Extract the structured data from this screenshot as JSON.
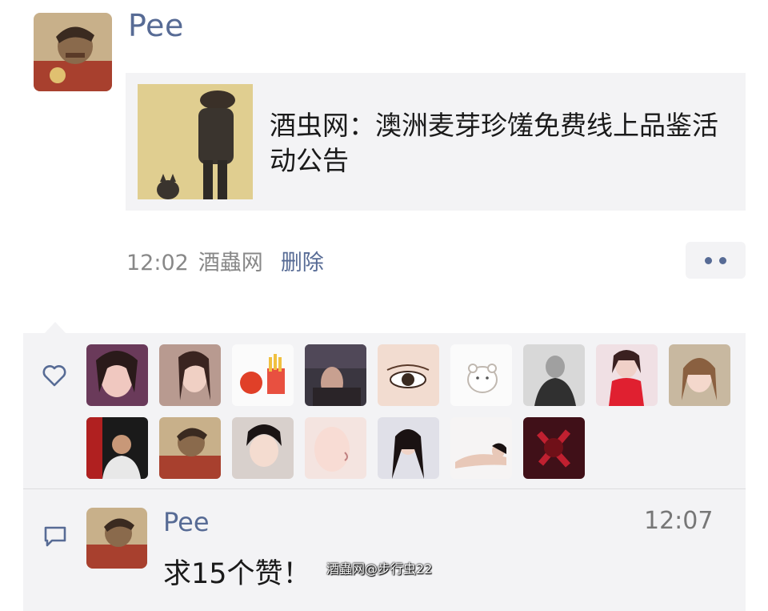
{
  "post": {
    "user": "Pee",
    "avatar": "iron-man-avatar",
    "link_card": {
      "thumbnail": "silhouette-man-with-cat-painting",
      "title": "酒虫网：澳洲麦芽珍馐免费线上品鉴活动公告"
    },
    "meta": {
      "time": "12:02",
      "source": "酒蟲网",
      "delete_label": "删除"
    },
    "more_icon": "more-dots-icon"
  },
  "likes": {
    "icon": "heart-icon",
    "avatars": [
      "woman-selfie",
      "woman-long-hair",
      "tomato-and-fries-cartoon",
      "woman-sitting-room",
      "eye-closeup",
      "bear-doodle",
      "monochrome-person-sitting",
      "woman-red-dress",
      "woman-bangs",
      "man-with-poster",
      "iron-man-avatar",
      "woman-portrait",
      "woman-face-closeup",
      "woman-black-hair",
      "woman-lying-bed",
      "dark-red-artwork"
    ]
  },
  "comment": {
    "icon": "comment-icon",
    "user": "Pee",
    "time": "12:07",
    "text": "求15个赞！"
  },
  "watermark": "酒蟲网@步行虫22",
  "colors": {
    "link_blue": "#576b95",
    "panel_bg": "#f3f3f5",
    "meta_gray": "#888888"
  }
}
